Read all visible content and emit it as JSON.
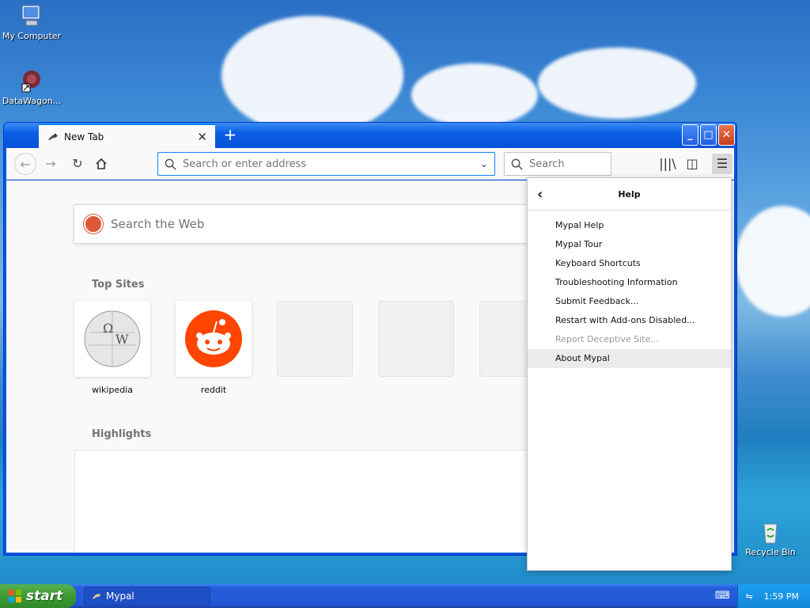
{
  "desktop": {
    "icons": [
      {
        "label": "My Computer",
        "icon": "computer-icon"
      },
      {
        "label": "DataWagon...",
        "icon": "datawagon-icon"
      },
      {
        "label": "Recycle Bin",
        "icon": "recycle-bin-icon"
      }
    ]
  },
  "browser": {
    "tab": {
      "title": "New Tab"
    },
    "urlbar": {
      "placeholder": "Search or enter address"
    },
    "searchbar": {
      "placeholder": "Search"
    },
    "page": {
      "websearch_placeholder": "Search the Web",
      "top_sites_title": "Top Sites",
      "highlights_title": "Highlights",
      "top_sites": [
        {
          "label": "wikipedia"
        },
        {
          "label": "reddit"
        }
      ]
    }
  },
  "help_panel": {
    "title": "Help",
    "items": [
      {
        "label": "Mypal Help"
      },
      {
        "label": "Mypal Tour"
      },
      {
        "label": "Keyboard Shortcuts"
      },
      {
        "label": "Troubleshooting Information"
      },
      {
        "label": "Submit Feedback..."
      },
      {
        "label": "Restart with Add-ons Disabled..."
      },
      {
        "label": "Report Deceptive Site..."
      },
      {
        "label": "About Mypal"
      }
    ]
  },
  "taskbar": {
    "start_label": "start",
    "task_label": "Mypal",
    "clock": "1:59 PM"
  }
}
